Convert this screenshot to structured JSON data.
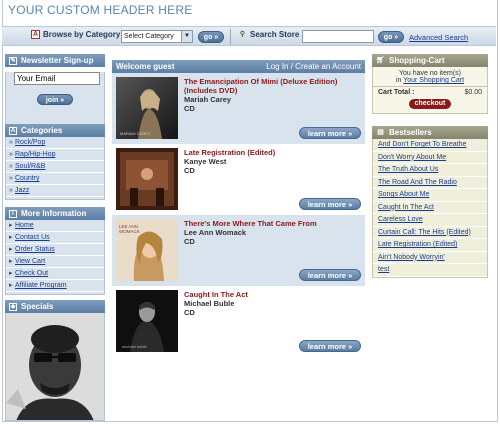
{
  "header": {
    "title": "YOUR CUSTOM HEADER HERE"
  },
  "topbar": {
    "browse_label": "Browse by Category",
    "category_select_value": "Select Category",
    "go_label": "go »",
    "search_label": "Search Store",
    "search_value": "",
    "search_go_label": "go »",
    "advanced_search": "Advanced Search"
  },
  "newsletter": {
    "title": "Newsletter Sign-up",
    "email_value": "Your Email",
    "join_label": "join »"
  },
  "categories": {
    "title": "Categories",
    "items": [
      "Rock/Pop",
      "Rap/Hip-Hop",
      "Soul/R&B",
      "Country",
      "Jazz"
    ]
  },
  "more_info": {
    "title": "More Information",
    "items": [
      "Home",
      "Contact Us",
      "Order Status",
      "View Cart",
      "Check Out",
      "Affiliate Program"
    ]
  },
  "specials": {
    "title": "Specials"
  },
  "welcome": {
    "guest": "Welcome guest",
    "links": "Log In / Create an Account"
  },
  "products": [
    {
      "title": "The Emancipation Of Mimi (Deluxe Edition) (Includes DVD)",
      "artist": "Mariah Carey",
      "format": "CD",
      "button": "learn more »"
    },
    {
      "title": "Late Registration (Edited)",
      "artist": "Kanye West",
      "format": "CD",
      "button": "learn more »"
    },
    {
      "title": "There's More Where That Came From",
      "artist": "Lee Ann Womack",
      "format": "CD",
      "button": "learn more »"
    },
    {
      "title": "Caught In The Act",
      "artist": "Michael Buble",
      "format": "CD",
      "button": "learn more »"
    }
  ],
  "cart": {
    "title": "Shopping-Cart",
    "line1": "You have no item(s)",
    "line2_prefix": "in",
    "line2_link": "Your Shopping Cart",
    "total_label": "Cart Total :",
    "total_value": "$0.00",
    "checkout_label": "checkout"
  },
  "bestsellers": {
    "title": "Bestsellers",
    "items": [
      "And Don't Forget To Breathe",
      "Don't Worry About Me",
      "The Truth About Us",
      "The Road And The Radio",
      "Songs About Me",
      "Caught In The Act",
      "Careless Love",
      "Curtain Call: The Hits (Edited)",
      "Late Registration (Edited)",
      "Ain't Nobody Worryin'",
      "test"
    ]
  }
}
